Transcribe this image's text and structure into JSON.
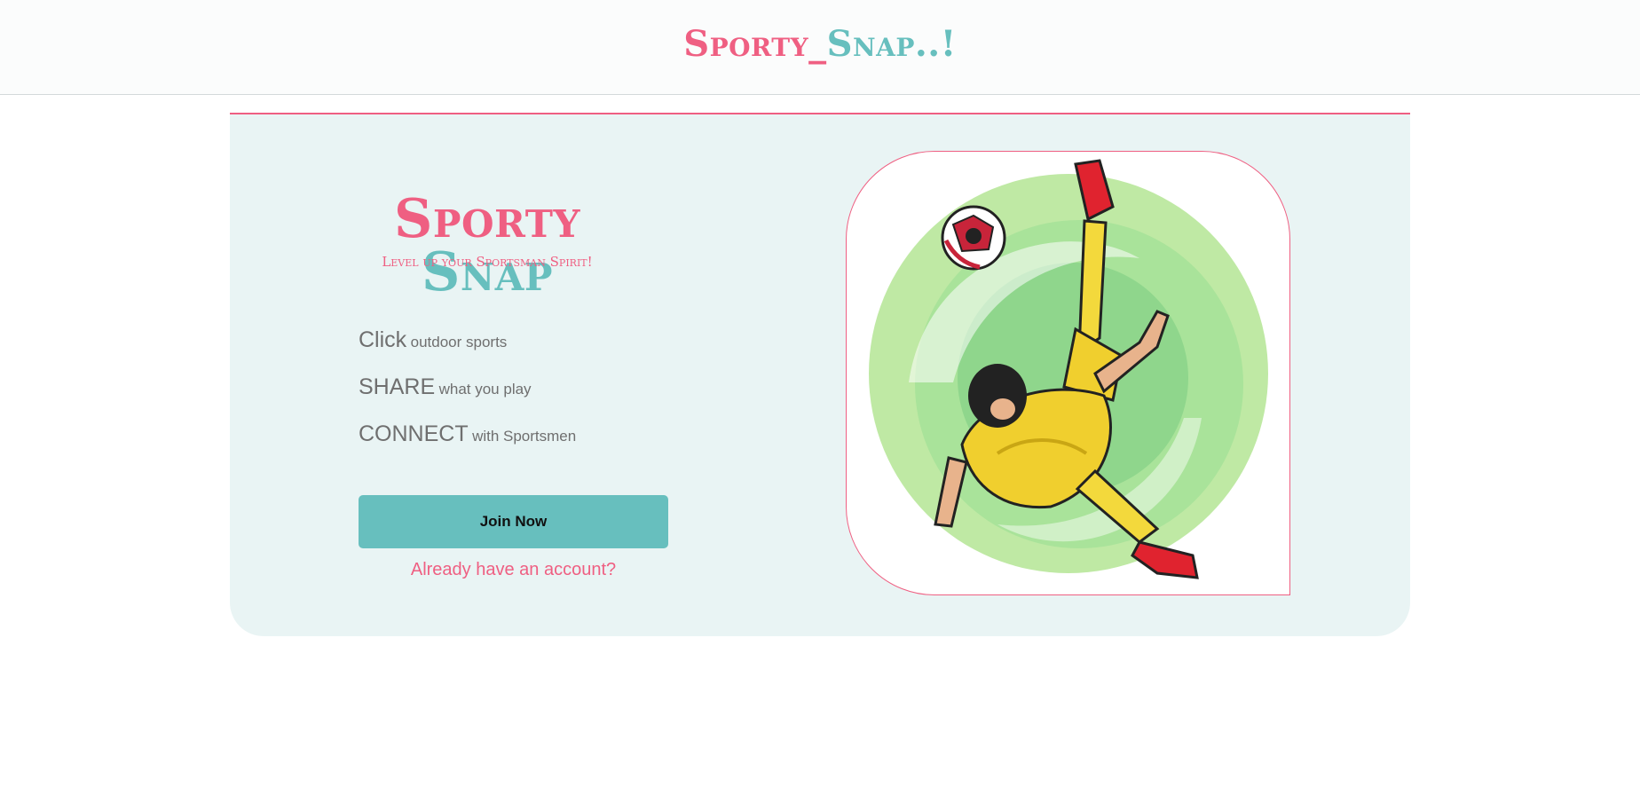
{
  "header": {
    "brand_part1": "Sporty_",
    "brand_part2": "Snap..!"
  },
  "hero": {
    "title_part1": "Sporty",
    "title_part2": "Snap",
    "tagline": "Level up your Sportsman Spirit!"
  },
  "features": [
    {
      "big": "Click",
      "small": "outdoor sports"
    },
    {
      "big": "SHARE",
      "small": "what you play"
    },
    {
      "big": "CONNECT",
      "small": "with Sportsmen"
    }
  ],
  "actions": {
    "join_label": "Join Now",
    "login_label": "Already have an account?"
  },
  "colors": {
    "accent_pink": "#ef5f82",
    "accent_teal": "#67bfbe",
    "card_bg": "#e9f4f4"
  },
  "illustration": {
    "icon": "bicycle-kick-footballer-illustration"
  }
}
